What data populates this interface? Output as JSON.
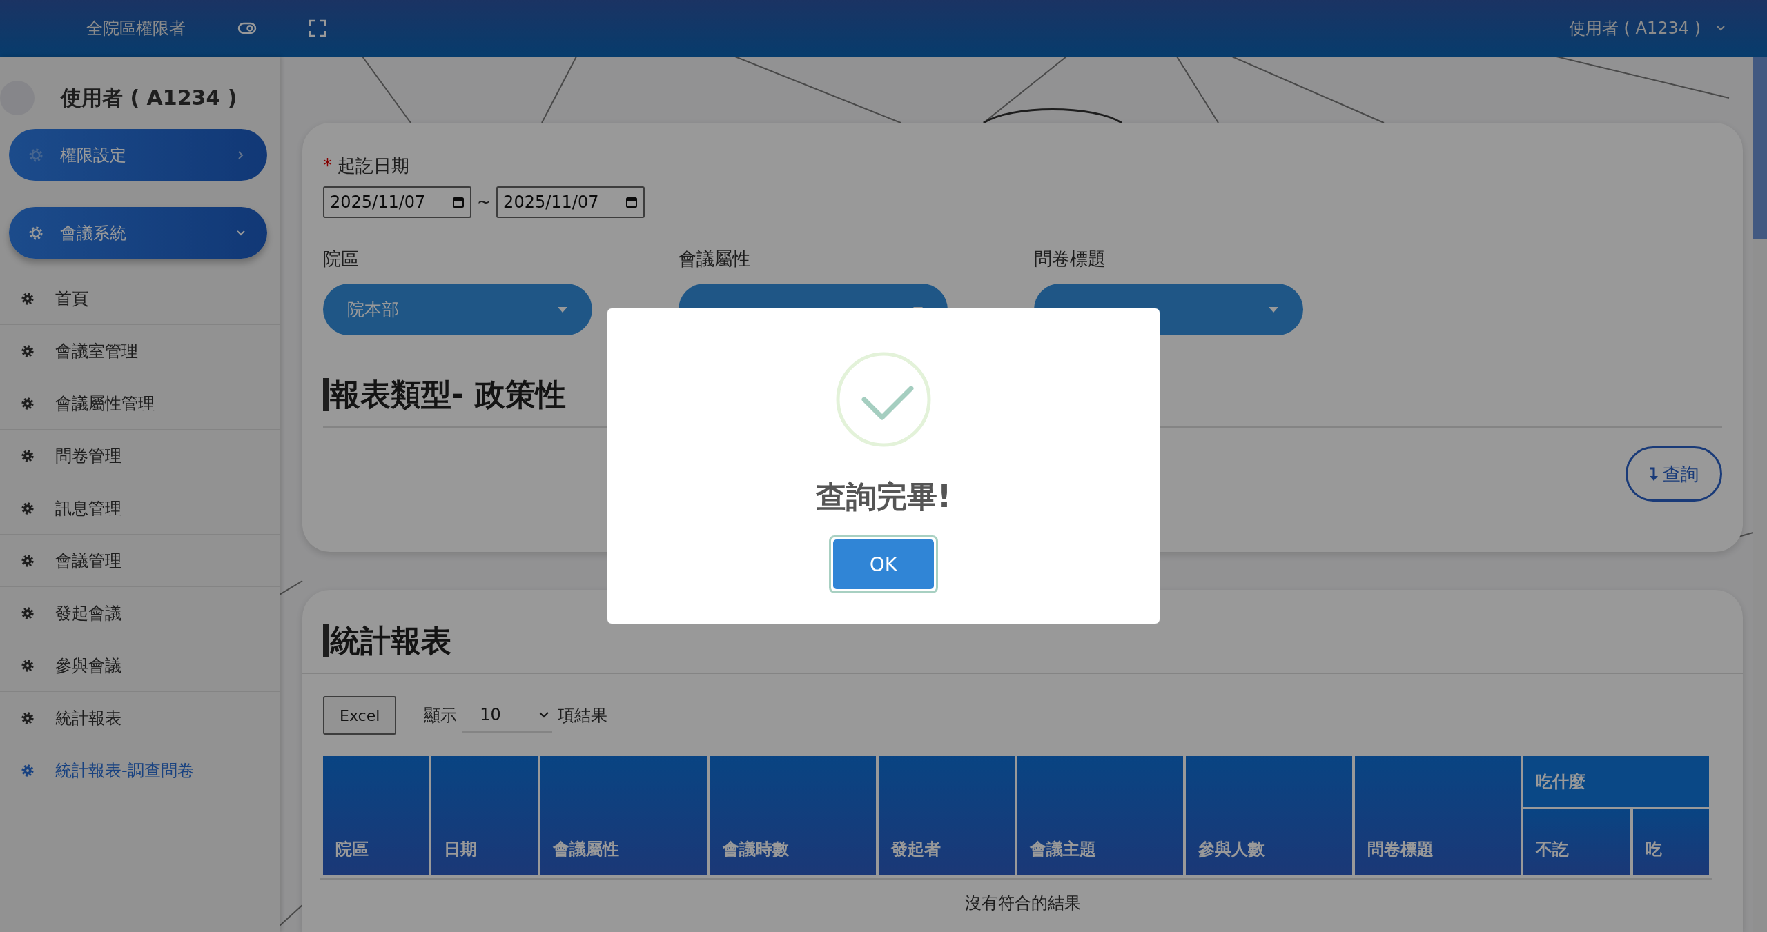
{
  "topbar": {
    "role": "全院區權限者",
    "user": "使用者 ( A1234 )"
  },
  "sidebar": {
    "user": "使用者 ( A1234 )",
    "groups": [
      {
        "label": "權限設定",
        "expanded": false
      },
      {
        "label": "會議系統",
        "expanded": true
      }
    ],
    "items": [
      {
        "label": "首頁",
        "selected": false
      },
      {
        "label": "會議室管理",
        "selected": false
      },
      {
        "label": "會議屬性管理",
        "selected": false
      },
      {
        "label": "問卷管理",
        "selected": false
      },
      {
        "label": "訊息管理",
        "selected": false
      },
      {
        "label": "會議管理",
        "selected": false
      },
      {
        "label": "發起會議",
        "selected": false
      },
      {
        "label": "參與會議",
        "selected": false
      },
      {
        "label": "統計報表",
        "selected": false
      },
      {
        "label": "統計報表-調查問卷",
        "selected": true
      }
    ]
  },
  "filters": {
    "date_label": "起訖日期",
    "required_mark": "*",
    "date_from": "2025/11/07",
    "separator": "~",
    "date_to": "2025/11/07",
    "selects": [
      {
        "label": "院區",
        "value": "院本部"
      },
      {
        "label": "會議屬性"
      },
      {
        "label": "問卷標題"
      }
    ],
    "report_type": "報表類型- 政策性",
    "query_button": "查詢"
  },
  "report": {
    "title": "統計報表",
    "excel_button": "Excel",
    "show_label": "顯示",
    "page_size": "10",
    "results_label": "項結果",
    "columns": [
      {
        "label": "院區"
      },
      {
        "label": "日期"
      },
      {
        "label": "會議屬性"
      },
      {
        "label": "會議時數"
      },
      {
        "label": "發起者"
      },
      {
        "label": "會議主題"
      },
      {
        "label": "參與人數"
      },
      {
        "label": "問卷標題"
      },
      {
        "label": "吃什麼",
        "children": [
          {
            "label": "不訖"
          },
          {
            "label": "吃"
          }
        ]
      }
    ],
    "empty_message": "沒有符合的結果"
  },
  "dialog": {
    "kind": "success",
    "title": "查詢完畢!",
    "button": "OK"
  }
}
